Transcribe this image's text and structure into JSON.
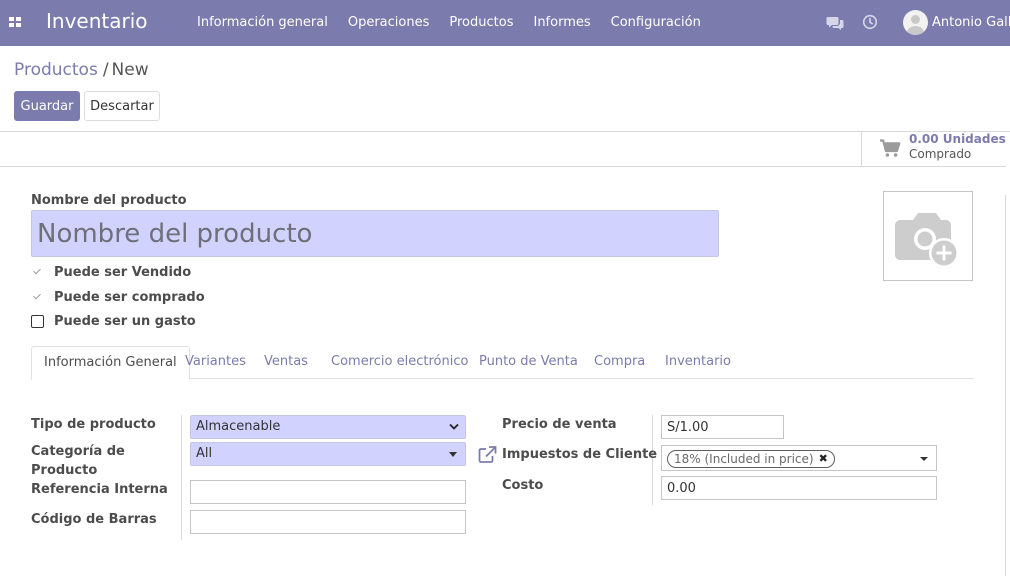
{
  "navbar": {
    "app_name": "Inventario",
    "menu": [
      "Información general",
      "Operaciones",
      "Productos",
      "Informes",
      "Configuración"
    ],
    "user_name": "Antonio Galli",
    "color": "#7c7bad"
  },
  "breadcrumb": {
    "parent": "Productos",
    "separator": "/",
    "current": "New"
  },
  "buttons": {
    "save": "Guardar",
    "discard": "Descartar"
  },
  "stat_button": {
    "value": "0.00 Unidades",
    "label": "Comprado",
    "icon": "cart-icon"
  },
  "product": {
    "name_label": "Nombre del producto",
    "name_placeholder": "Nombre del producto",
    "checkboxes": [
      {
        "label": "Puede ser Vendido",
        "checked": true
      },
      {
        "label": "Puede ser comprado",
        "checked": true
      },
      {
        "label": "Puede ser un gasto",
        "checked": false
      }
    ],
    "image_icon": "camera-plus-icon"
  },
  "tabs": [
    "Información General",
    "Variantes",
    "Ventas",
    "Comercio electrónico",
    "Punto de Venta",
    "Compra",
    "Inventario"
  ],
  "active_tab": "Información General",
  "fields_left": {
    "tipo_label": "Tipo de producto",
    "tipo_value": "Almacenable",
    "categoria_label": "Categoría de Producto",
    "categoria_value": "All",
    "referencia_label": "Referencia Interna",
    "referencia_value": "",
    "barras_label": "Código de Barras",
    "barras_value": ""
  },
  "fields_right": {
    "precio_label": "Precio de venta",
    "precio_value": "S/1.00",
    "impuestos_label": "Impuestos de Cliente",
    "impuestos_tag": "18% (Included in price)",
    "costo_label": "Costo",
    "costo_value": "0.00"
  }
}
